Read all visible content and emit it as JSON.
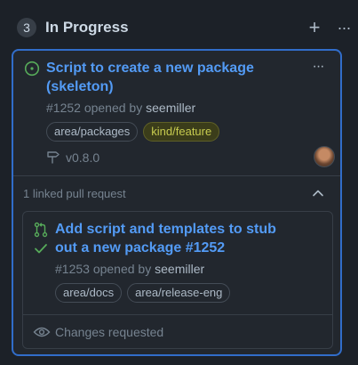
{
  "column": {
    "count": "3",
    "title": "In Progress",
    "add_label": "+",
    "more_label": "···"
  },
  "card": {
    "title": "Script to create a new package (skeleton)",
    "number": "#1252",
    "opened_by": "opened by",
    "author": "seemiller",
    "labels": [
      "area/packages",
      "kind/feature"
    ],
    "milestone": "v0.8.0",
    "more_label": "···",
    "linked_text": "1 linked pull request",
    "status_color": "#57ab5a"
  },
  "pull_request": {
    "title": "Add script and templates to stub out a new package #1252",
    "number": "#1253",
    "opened_by": "opened by",
    "author": "seemiller",
    "labels": [
      "area/docs",
      "area/release-eng"
    ],
    "review_status": "Changes requested"
  },
  "colors": {
    "accent": "#539bf5",
    "focus_border": "#316dca",
    "success": "#57ab5a",
    "feature_label": "#c6cb4f"
  }
}
